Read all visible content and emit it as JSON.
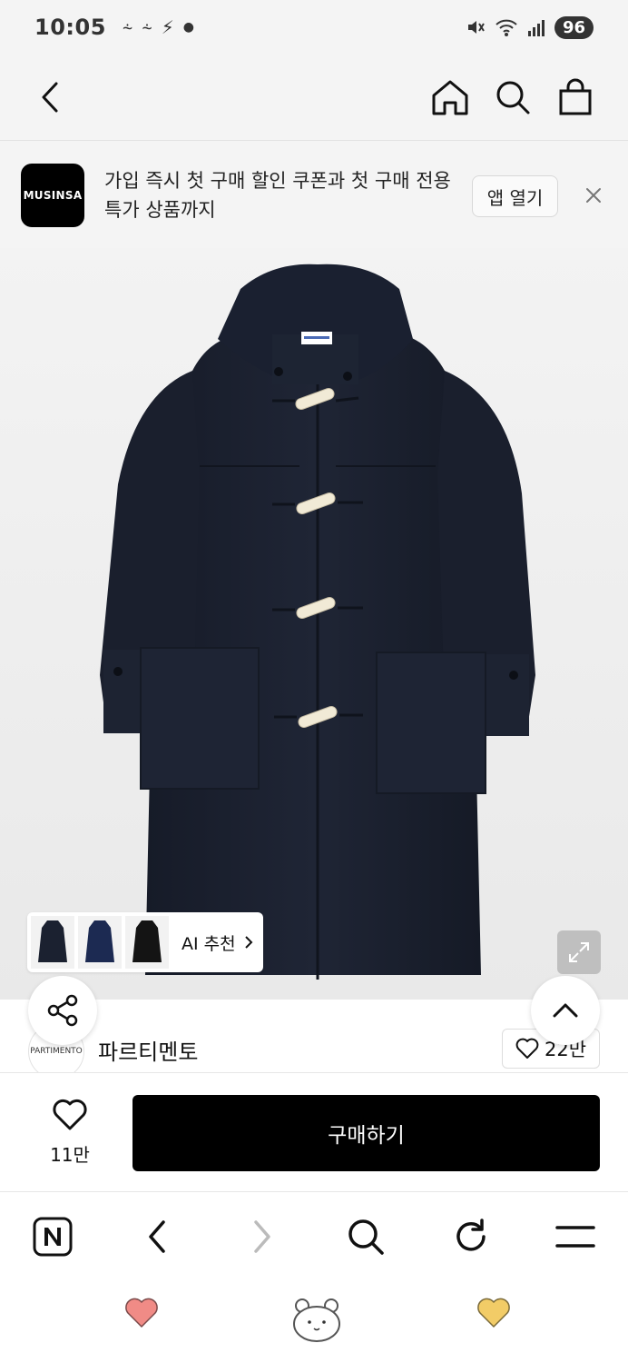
{
  "status_bar": {
    "time": "10:05",
    "battery": "96"
  },
  "top_nav": {
    "icons": [
      "back-arrow-icon",
      "home-icon",
      "search-icon",
      "shopping-bag-icon"
    ]
  },
  "banner": {
    "logo_text": "MUSINSA",
    "message": "가입 즉시 첫 구매 할인 쿠폰과 첫 구매 전용 특가 상품까지",
    "app_open_label": "앱 열기"
  },
  "product_image": {
    "ai_recommend_label": "AI 추천",
    "colors": {
      "coat": "#1b2130",
      "toggle": "#f1ead6"
    }
  },
  "brand": {
    "avatar_text": "PARTIMENTO",
    "name": "파르티멘토",
    "like_count": "22만"
  },
  "purchase_bar": {
    "like_count": "11만",
    "buy_label": "구매하기"
  },
  "browser_nav": {
    "icons": [
      "naver-icon",
      "browser-back-icon",
      "browser-forward-icon",
      "browser-search-icon",
      "refresh-icon",
      "menu-icon"
    ]
  },
  "system_nav": {
    "colors": {
      "left_heart": "#f08b86",
      "right_heart": "#f2cc67"
    }
  }
}
